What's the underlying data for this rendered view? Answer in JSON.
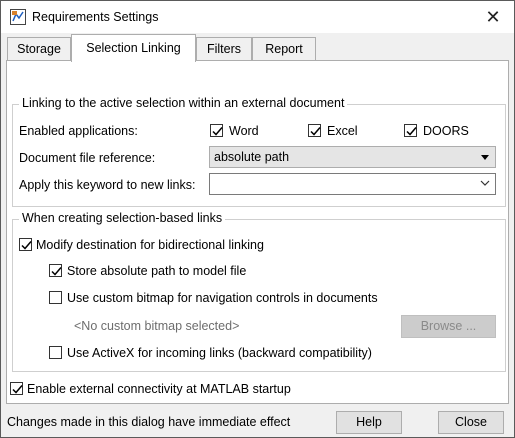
{
  "window": {
    "title": "Requirements Settings",
    "app_icon": "simulink-icon",
    "close_icon": "close-icon"
  },
  "tabs": [
    {
      "label": "Storage",
      "active": false
    },
    {
      "label": "Selection Linking",
      "active": true
    },
    {
      "label": "Filters",
      "active": false
    },
    {
      "label": "Report",
      "active": false
    }
  ],
  "group1": {
    "legend": "Linking to the active selection within an external document",
    "enabled_apps_label": "Enabled applications:",
    "apps": [
      {
        "label": "Word",
        "checked": true
      },
      {
        "label": "Excel",
        "checked": true
      },
      {
        "label": "DOORS",
        "checked": true
      }
    ],
    "doc_ref_label": "Document file reference:",
    "doc_ref_value": "absolute path",
    "keyword_label": "Apply this keyword to new links:",
    "keyword_value": ""
  },
  "group2": {
    "legend": "When creating selection-based links",
    "modify_dest": {
      "label": "Modify destination for bidirectional linking",
      "checked": true
    },
    "store_abs": {
      "label": "Store absolute path to model file",
      "checked": true
    },
    "custom_bitmap": {
      "label": "Use custom bitmap for navigation controls in documents",
      "checked": false
    },
    "bitmap_placeholder": "<No custom bitmap selected>",
    "browse_label": "Browse ...",
    "activex": {
      "label": "Use ActiveX for incoming links (backward compatibility)",
      "checked": false
    }
  },
  "enable_ext": {
    "label": "Enable external connectivity at MATLAB startup",
    "checked": true
  },
  "footer": {
    "status": "Changes made in this dialog have immediate effect",
    "help_label": "Help",
    "close_label": "Close"
  }
}
